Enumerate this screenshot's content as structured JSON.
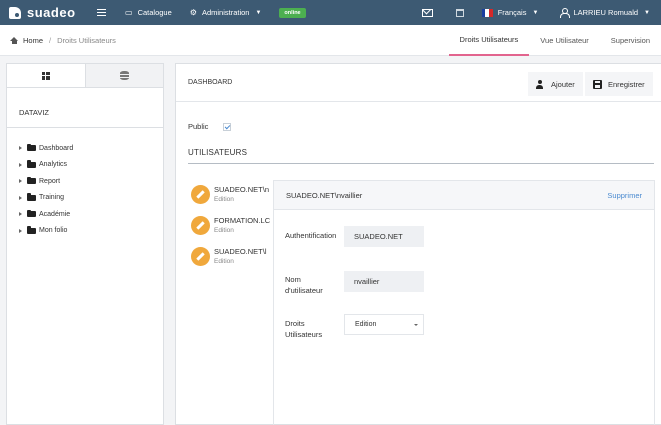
{
  "topbar": {
    "brand": "suadeo",
    "nav": [
      {
        "label": "Catalogue",
        "icon": "window-icon"
      },
      {
        "label": "Administration",
        "icon": "settings-icon"
      }
    ],
    "status_badge": "online",
    "language": "Français",
    "user": "LARRIEU Romuald"
  },
  "breadcrumb": {
    "home": "Home",
    "current": "Droits Utilisateurs"
  },
  "tabs": [
    {
      "label": "Droits Utilisateurs",
      "active": true
    },
    {
      "label": "Vue Utilisateur",
      "active": false
    },
    {
      "label": "Supervision",
      "active": false
    }
  ],
  "sidebar": {
    "title": "DATAVIZ",
    "items": [
      {
        "label": "Dashboard"
      },
      {
        "label": "Analytics"
      },
      {
        "label": "Report"
      },
      {
        "label": "Training"
      },
      {
        "label": "Académie"
      },
      {
        "label": "Mon folio"
      }
    ]
  },
  "main": {
    "title": "DASHBOARD",
    "add_label": "Ajouter",
    "save_label": "Enregistrer",
    "public_label": "Public",
    "public_checked": true,
    "users_title": "UTILISATEURS",
    "users": [
      {
        "name": "SUADEO.NET\\n",
        "role": "Edition"
      },
      {
        "name": "FORMATION.LC",
        "role": "Edition"
      },
      {
        "name": "SUADEO.NET\\l",
        "role": "Edition"
      }
    ],
    "detail": {
      "title": "SUADEO.NET\\nvaillier",
      "delete_label": "Supprimer",
      "auth_label": "Authentification",
      "auth_value": "SUADEO.NET",
      "username_label": "Nom d'utilisateur",
      "username_value": "nvaillier",
      "rights_label": "Droits Utilisateurs",
      "rights_value": "Edition"
    }
  },
  "colors": {
    "topbar": "#3d5a73",
    "accent_tab": "#e2648e",
    "online_badge": "#4caf50",
    "edit_icon": "#f0a83c",
    "link": "#4a8ad0"
  }
}
